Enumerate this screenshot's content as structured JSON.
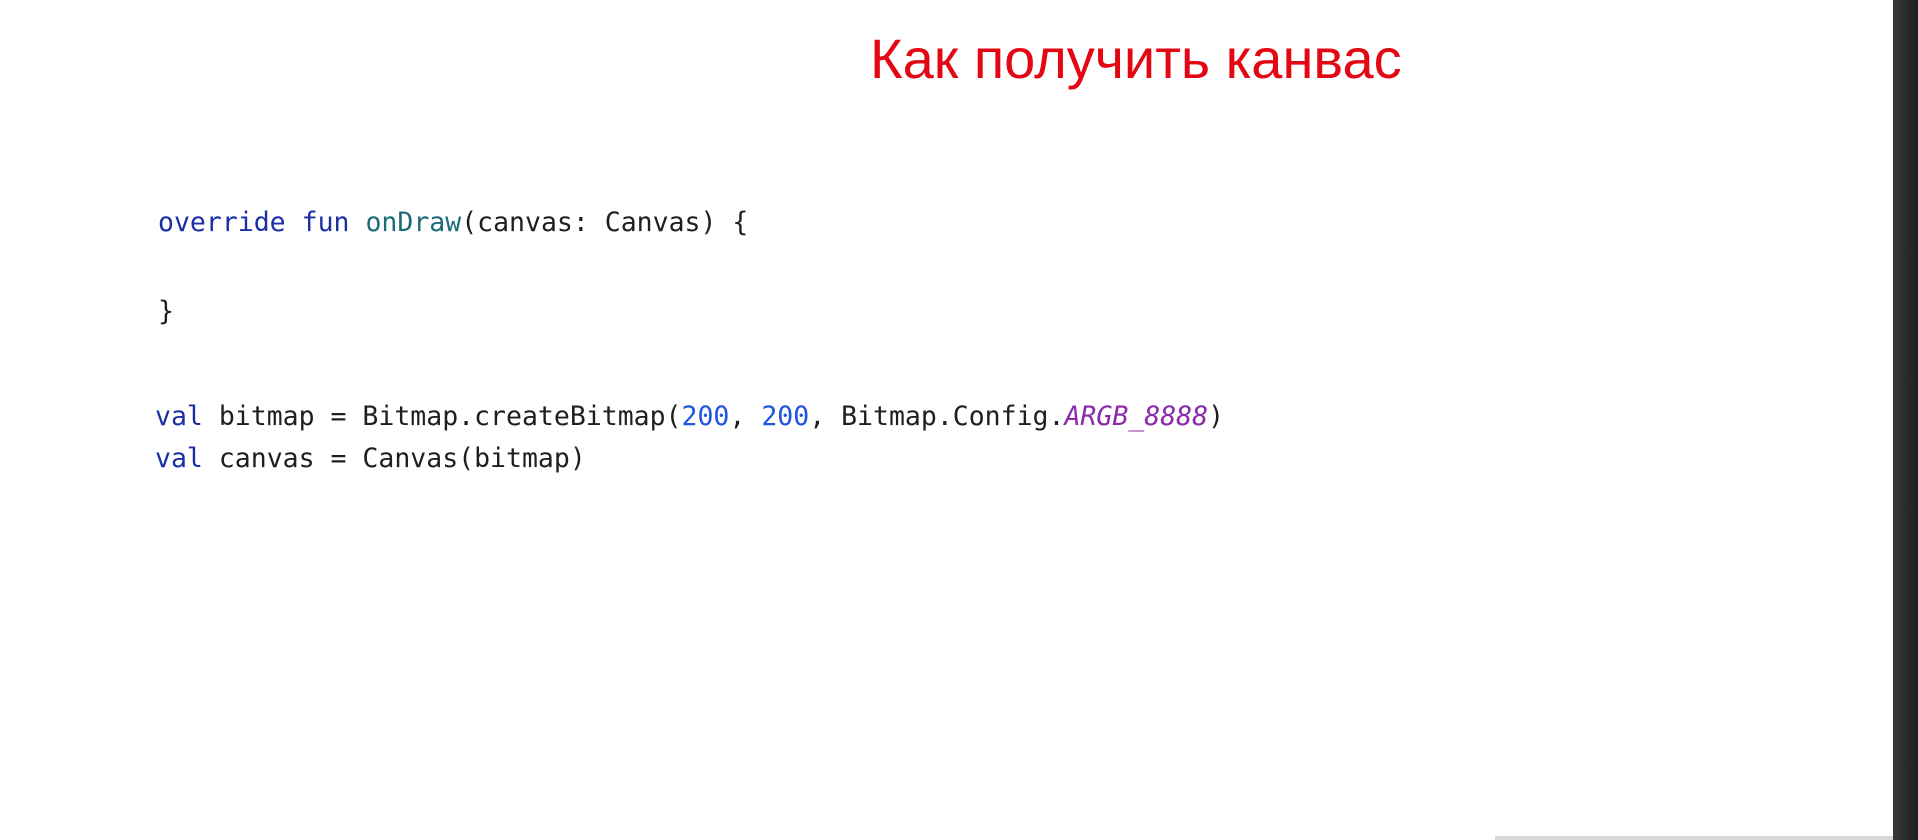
{
  "title": "Как получить канвас",
  "colors": {
    "title": "#e30613",
    "keyword": "#1a2fa3",
    "function_name": "#1b6b7a",
    "number": "#1f55e0",
    "constant": "#8a2aa8",
    "plain": "#1f1f1f"
  },
  "code": {
    "line1": {
      "kw_override": "override",
      "sp1": " ",
      "kw_fun": "fun",
      "sp2": " ",
      "fn_name": "onDraw",
      "rest": "(canvas: Canvas) {"
    },
    "line2": {
      "text": "}"
    },
    "line3": {
      "kw_val": "val",
      "mid1": " bitmap = Bitmap.createBitmap(",
      "num1": "200",
      "sep": ", ",
      "num2": "200",
      "mid2": ", Bitmap.Config.",
      "const": "ARGB_8888",
      "end": ")"
    },
    "line4": {
      "kw_val": "val",
      "rest": " canvas = Canvas(bitmap)"
    }
  }
}
